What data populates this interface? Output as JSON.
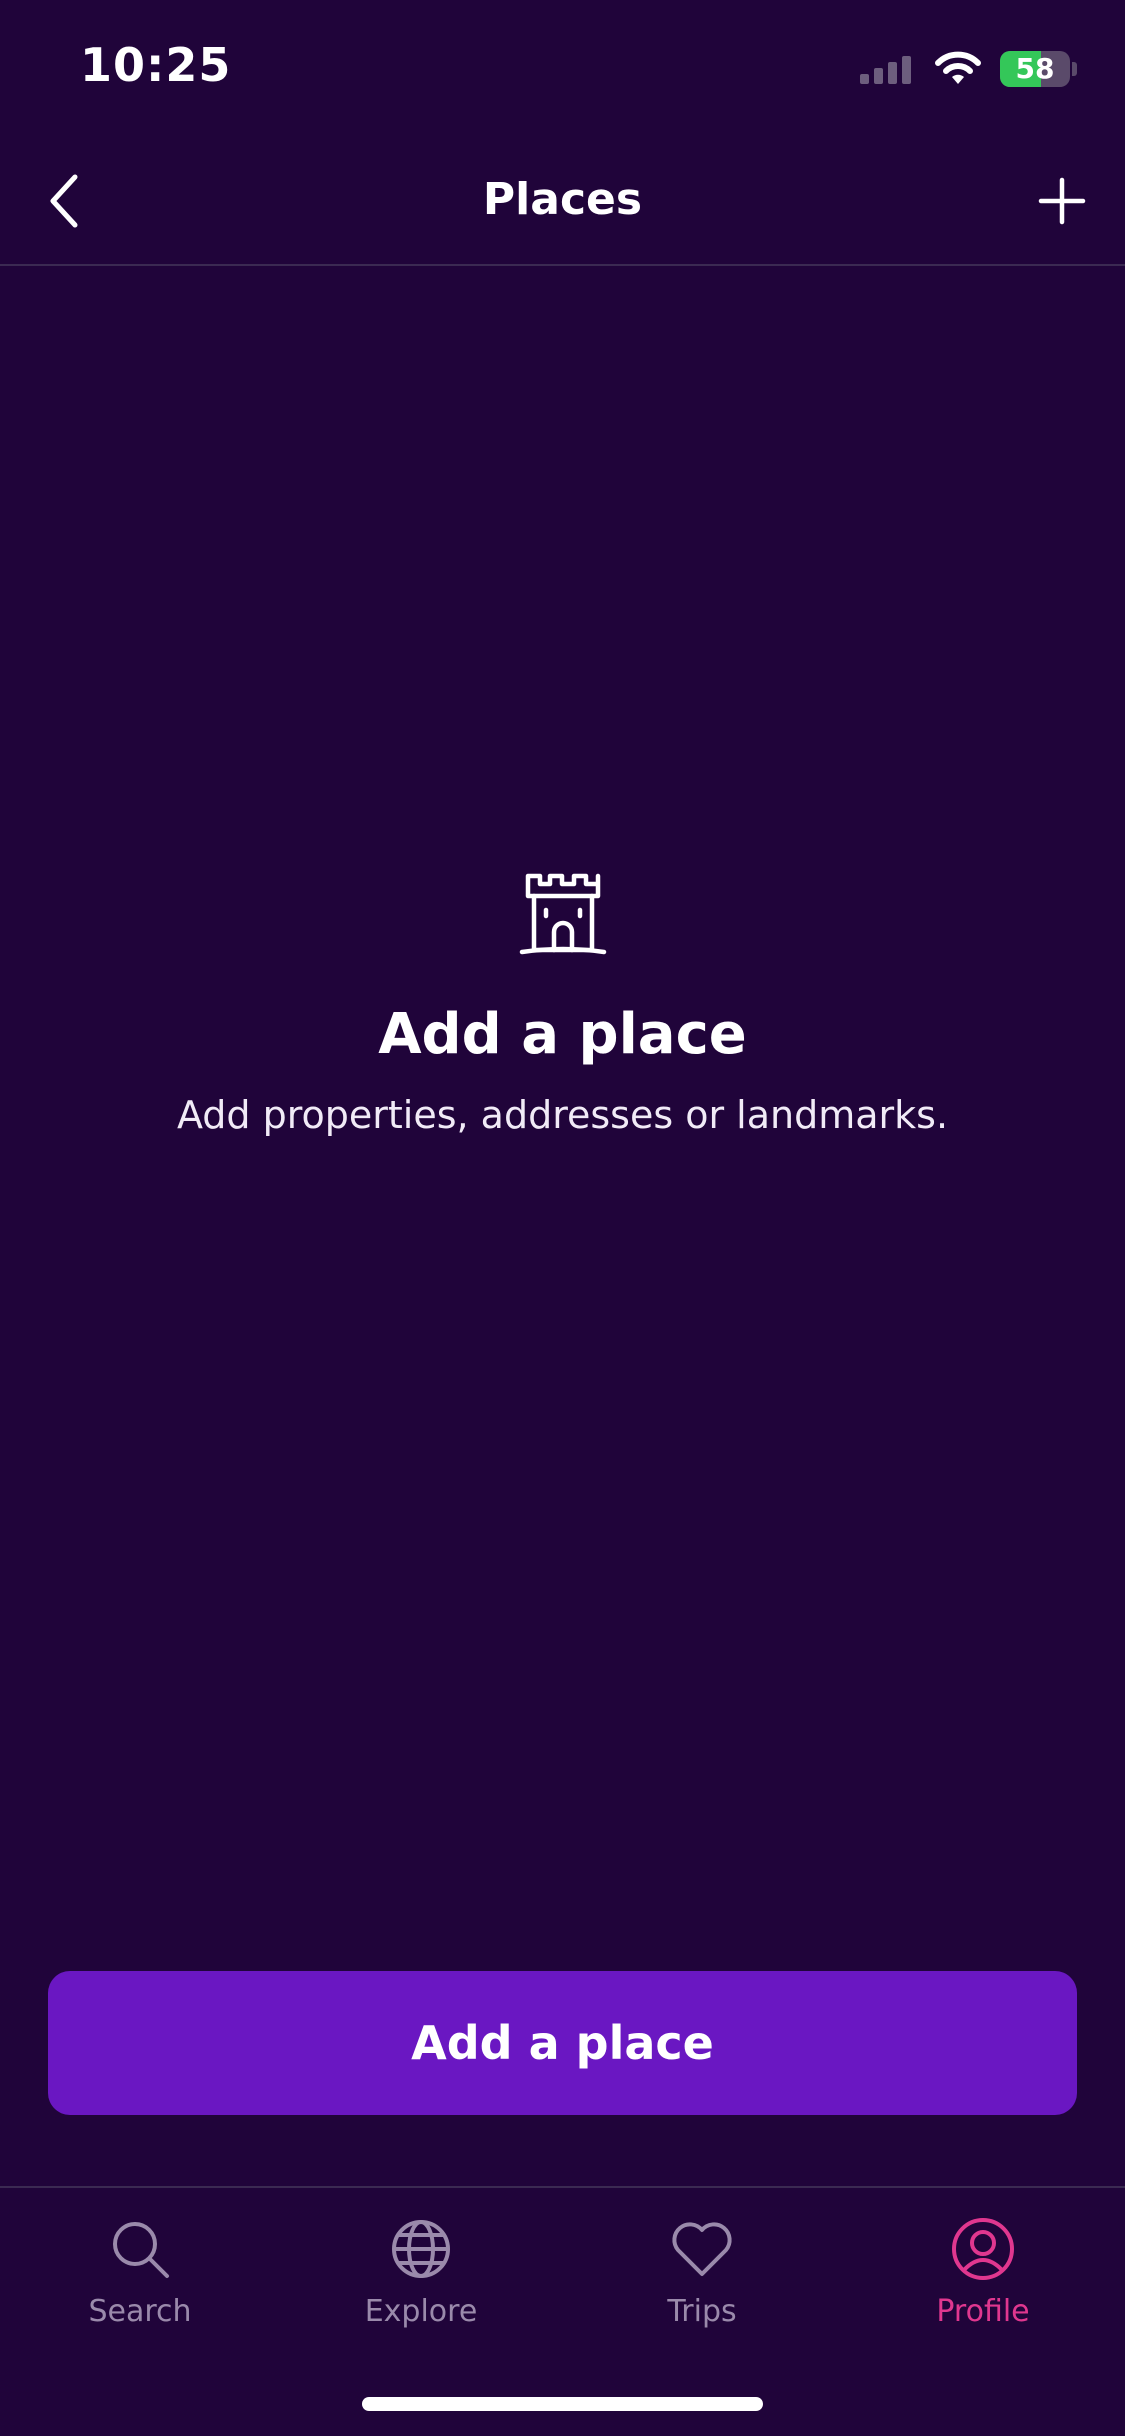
{
  "status_bar": {
    "time": "10:25",
    "battery_level": 58,
    "battery_text": "58",
    "battery_color": "#34c759"
  },
  "nav": {
    "title": "Places",
    "back_icon": "chevron-left-icon",
    "add_icon": "plus-icon"
  },
  "empty_state": {
    "icon": "castle-icon",
    "title": "Add a place",
    "subtitle": "Add properties, addresses or landmarks."
  },
  "primary_button": {
    "label": "Add a place",
    "color": "#6a17c2"
  },
  "tab_bar": {
    "active_color": "#e0378f",
    "inactive_color": "#9a8aab",
    "tabs": [
      {
        "label": "Search",
        "icon": "search-icon",
        "active": false
      },
      {
        "label": "Explore",
        "icon": "globe-icon",
        "active": false
      },
      {
        "label": "Trips",
        "icon": "heart-icon",
        "active": false
      },
      {
        "label": "Profile",
        "icon": "profile-icon",
        "active": true
      }
    ]
  },
  "colors": {
    "background": "#20043a",
    "divider": "#3b2a52"
  }
}
